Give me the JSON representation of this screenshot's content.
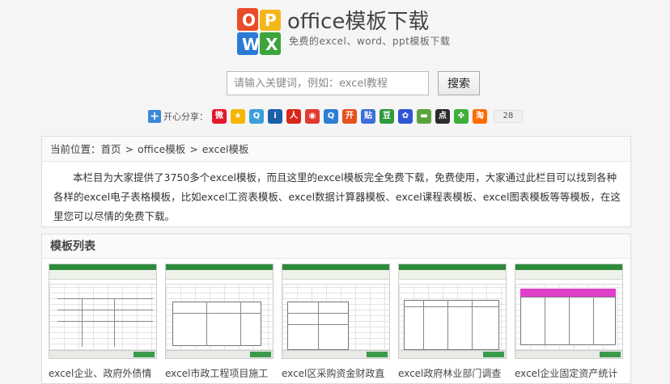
{
  "header": {
    "site_title": "office模板下载",
    "site_subtitle": "免费的excel、word、ppt模板下载"
  },
  "search": {
    "placeholder": "请输入关键词，例如：excel教程",
    "button_label": "搜索"
  },
  "share": {
    "label": "开心分享：",
    "count": "28",
    "icons": [
      "weibo-icon",
      "qzone-icon",
      "tqq-icon",
      "renren-icon",
      "people-icon",
      "sina-icon",
      "qq-icon",
      "kaixin-icon",
      "tieba-icon",
      "douban-icon",
      "baidu-icon",
      "youdao-icon",
      "diandian-icon",
      "clover-icon",
      "taobao-icon"
    ]
  },
  "breadcrumb": {
    "prefix": "当前位置：",
    "items": [
      "首页",
      "office模板",
      "excel模板"
    ],
    "separator": ">"
  },
  "intro": {
    "text": "本栏目为大家提供了3750多个excel模板，而且这里的excel模板完全免费下载，免费使用，大家通过此栏目可以找到各种各样的excel电子表格模板，比如excel工资表模板、excel数据计算器模板、excel课程表模板、excel图表模板等等模板，在这里您可以尽情的免费下载。"
  },
  "template_list": {
    "title": "模板列表",
    "items": [
      {
        "caption": "excel企业、政府外债情"
      },
      {
        "caption": "excel市政工程项目施工"
      },
      {
        "caption": "excel区采购资金财政直"
      },
      {
        "caption": "excel政府林业部门调查"
      },
      {
        "caption": "excel企业固定资产统计"
      }
    ]
  },
  "colors": {
    "accent_green": "#2e8b3b",
    "share_plus_blue": "#3b87d6"
  }
}
